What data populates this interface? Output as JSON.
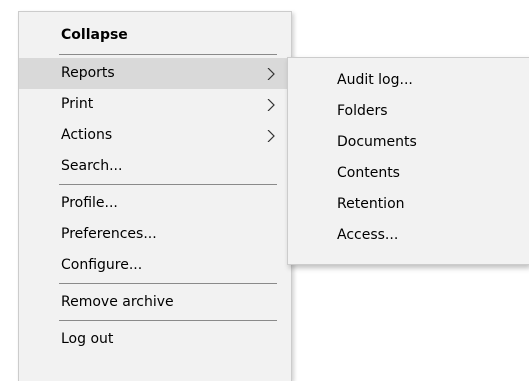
{
  "main_menu": {
    "header": "Collapse",
    "items_group1": [
      {
        "label": "Reports",
        "has_submenu": true,
        "highlighted": true
      },
      {
        "label": "Print",
        "has_submenu": true
      },
      {
        "label": "Actions",
        "has_submenu": true
      },
      {
        "label": "Search..."
      }
    ],
    "items_group2": [
      {
        "label": "Profile..."
      },
      {
        "label": "Preferences..."
      },
      {
        "label": "Configure..."
      }
    ],
    "items_group3": [
      {
        "label": "Remove archive"
      }
    ],
    "items_group4": [
      {
        "label": "Log out"
      }
    ]
  },
  "submenu": {
    "items": [
      {
        "label": "Audit log..."
      },
      {
        "label": "Folders"
      },
      {
        "label": "Documents"
      },
      {
        "label": "Contents"
      },
      {
        "label": "Retention"
      },
      {
        "label": "Access..."
      }
    ]
  },
  "icons": {
    "submenu_arrow": "chevron-right-icon"
  },
  "colors": {
    "menu_bg": "#f2f2f2",
    "highlight_bg": "#d9d9d9",
    "separator": "#8a8a8a"
  }
}
